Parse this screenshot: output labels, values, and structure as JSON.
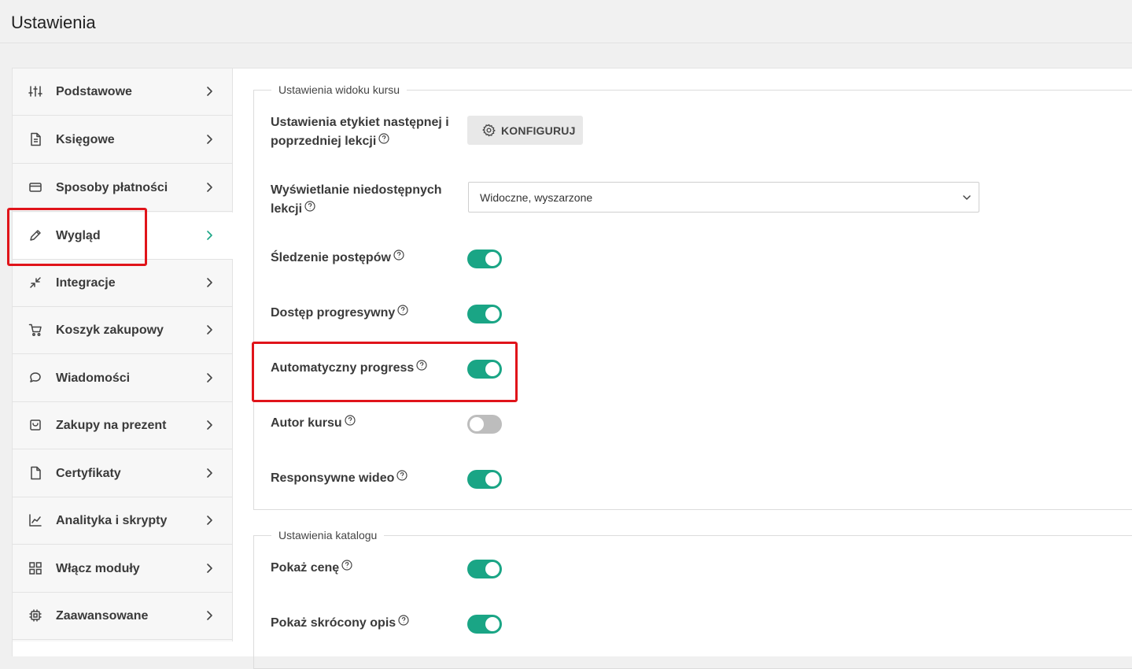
{
  "page": {
    "title": "Ustawienia"
  },
  "colors": {
    "accent": "#1aa585",
    "highlight": "#e0141a",
    "toggle_off": "#bdbdbd"
  },
  "sidebar": {
    "items": [
      {
        "label": "Podstawowe",
        "icon": "sliders-icon"
      },
      {
        "label": "Księgowe",
        "icon": "document-icon"
      },
      {
        "label": "Sposoby płatności",
        "icon": "credit-card-icon"
      },
      {
        "label": "Wygląd",
        "icon": "pencil-icon",
        "active": true
      },
      {
        "label": "Integracje",
        "icon": "arrows-collapse-icon"
      },
      {
        "label": "Koszyk zakupowy",
        "icon": "cart-icon"
      },
      {
        "label": "Wiadomości",
        "icon": "chat-bubble-icon"
      },
      {
        "label": "Zakupy na prezent",
        "icon": "shopping-bag-icon"
      },
      {
        "label": "Certyfikaty",
        "icon": "file-icon"
      },
      {
        "label": "Analityka i skrypty",
        "icon": "line-chart-icon"
      },
      {
        "label": "Włącz moduły",
        "icon": "grid-icon"
      },
      {
        "label": "Zaawansowane",
        "icon": "chip-icon"
      }
    ]
  },
  "course_view": {
    "legend": "Ustawienia widoku kursu",
    "labels_setting": {
      "label_line1": "Ustawienia etykiet następnej i",
      "label_line2": "poprzedniej lekcji",
      "button_label": "KONFIGURUJ"
    },
    "unavailable_lessons": {
      "label_line1": "Wyświetlanie niedostępnych",
      "label_line2": "lekcji",
      "selected_value": "Widoczne, wyszarzone"
    },
    "toggles": [
      {
        "label": "Śledzenie postępów",
        "on": true
      },
      {
        "label": "Dostęp progresywny",
        "on": true
      },
      {
        "label": "Automatyczny progress",
        "on": true
      },
      {
        "label": "Autor kursu",
        "on": false
      },
      {
        "label": "Responsywne wideo",
        "on": true
      }
    ]
  },
  "catalog": {
    "legend": "Ustawienia katalogu",
    "toggles": [
      {
        "label": "Pokaż cenę",
        "on": true
      },
      {
        "label": "Pokaż skrócony opis",
        "on": true
      }
    ]
  }
}
